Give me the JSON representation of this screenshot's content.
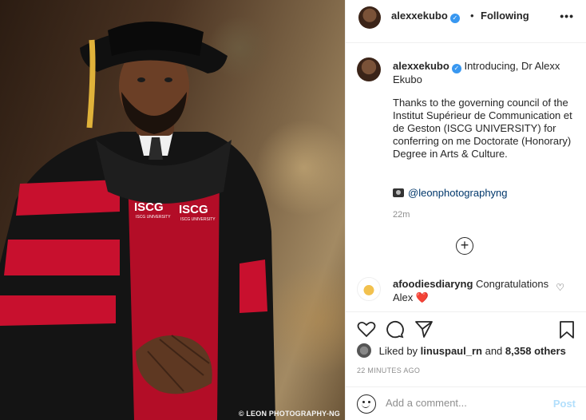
{
  "photo": {
    "credit": "© LEON PHOTOGRAPHY-NG",
    "badge_text": "ISCG",
    "badge_sub": "ISCG UNIVERSITY"
  },
  "header": {
    "username": "alexxekubo",
    "separator": "•",
    "following_label": "Following",
    "more_icon": "more-dots-icon"
  },
  "caption": {
    "username": "alexxekubo",
    "intro": "Introducing, Dr Alexx Ekubo",
    "body": "Thanks to the governing council of the Institut Supérieur de Communication et de Geston (ISCG UNIVERSITY) for conferring on me Doctorate (Honorary) Degree in Arts & Culture.",
    "link": "@leonphotographyng",
    "time": "22m"
  },
  "comment": {
    "username": "afoodiesdiaryng",
    "text": "Congratulations Alex",
    "emoji": "❤️"
  },
  "actions": {
    "icons": [
      "heart-icon",
      "comment-icon",
      "share-icon",
      "bookmark-icon"
    ]
  },
  "likes": {
    "prefix": "Liked by",
    "user": "linuspaul_rn",
    "joiner": "and",
    "others": "8,358 others"
  },
  "timestamp": "22 MINUTES AGO",
  "add_comment": {
    "placeholder": "Add a comment...",
    "post_label": "Post"
  },
  "colors": {
    "verified": "#3897f0",
    "link": "#00376b",
    "post_disabled": "#b2dffc",
    "gown_red": "#c8102e",
    "gown_black": "#141414"
  }
}
